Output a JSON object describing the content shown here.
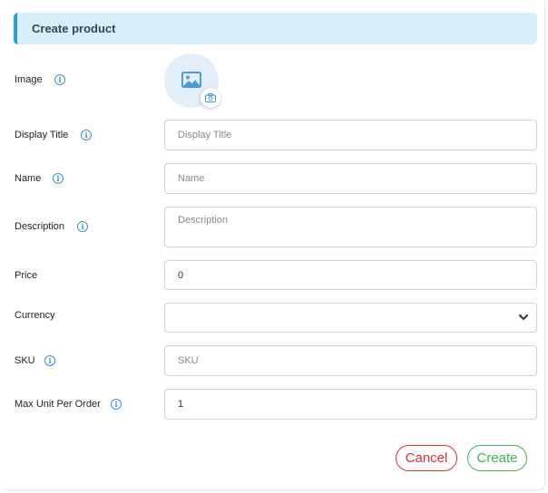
{
  "header": {
    "title": "Create product"
  },
  "form": {
    "image": {
      "label": "Image"
    },
    "display_title": {
      "label": "Display Title",
      "placeholder": "Display Title"
    },
    "name": {
      "label": "Name",
      "placeholder": "Name"
    },
    "description": {
      "label": "Description",
      "placeholder": "Description"
    },
    "price": {
      "label": "Price",
      "value": "0"
    },
    "currency": {
      "label": "Currency",
      "value": ""
    },
    "sku": {
      "label": "SKU",
      "placeholder": "SKU"
    },
    "max_unit": {
      "label": "Max Unit Per Order",
      "value": "1"
    }
  },
  "actions": {
    "cancel_label": "Cancel",
    "create_label": "Create"
  },
  "icons": {
    "info": "info-circle-icon",
    "image_placeholder": "image-icon",
    "camera": "camera-icon",
    "chevron": "chevron-down-icon"
  },
  "colors": {
    "accent": "#2a9fd6",
    "header_bg": "#d6effb",
    "cancel": "#d9332e",
    "create": "#3fb25a"
  }
}
